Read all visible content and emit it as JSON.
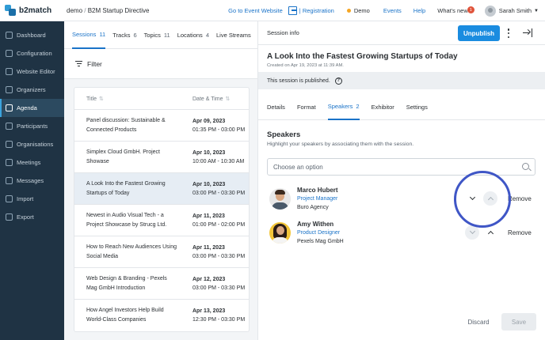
{
  "brand": {
    "name": "b2match"
  },
  "breadcrumb": {
    "org": "demo",
    "event": "B2M Startup Directive"
  },
  "topnav": {
    "go_to_event": "Go to Event Website",
    "registration": "Registration",
    "demo": "Demo",
    "events": "Events",
    "help": "Help",
    "whats_new": "What's new",
    "whats_new_count": "1",
    "user": "Sarah Smith"
  },
  "sidebar": {
    "items": [
      {
        "label": "Dashboard",
        "icon": "dashboard-icon"
      },
      {
        "label": "Configuration",
        "icon": "configuration-icon"
      },
      {
        "label": "Website Editor",
        "icon": "website-editor-icon"
      },
      {
        "label": "Organizers",
        "icon": "organizers-icon"
      },
      {
        "label": "Agenda",
        "icon": "agenda-icon",
        "active": true
      },
      {
        "label": "Participants",
        "icon": "participants-icon"
      },
      {
        "label": "Organisations",
        "icon": "organisations-icon"
      },
      {
        "label": "Meetings",
        "icon": "meetings-icon"
      },
      {
        "label": "Messages",
        "icon": "messages-icon"
      },
      {
        "label": "Import",
        "icon": "import-icon"
      },
      {
        "label": "Export",
        "icon": "export-icon"
      }
    ]
  },
  "agenda_tabs": [
    {
      "label": "Sessions",
      "count": "11",
      "active": true
    },
    {
      "label": "Tracks",
      "count": "6"
    },
    {
      "label": "Topics",
      "count": "11"
    },
    {
      "label": "Locations",
      "count": "4"
    },
    {
      "label": "Live Streams",
      "count": ""
    }
  ],
  "filter": {
    "label": "Filter"
  },
  "sessions_table": {
    "columns": [
      "Title",
      "Date & Time"
    ],
    "rows": [
      {
        "title": "Panel discussion: Sustainable & Connected Products",
        "date": "Apr 09, 2023",
        "time": "01:35 PM - 03:00 PM"
      },
      {
        "title": "Simplex Cloud GmbH. Project Showase",
        "date": "Apr 10, 2023",
        "time": "10:00 AM - 10:30 AM"
      },
      {
        "title": "A Look Into the Fastest Growing Startups of Today",
        "date": "Apr 10, 2023",
        "time": "03:00 PM - 03:30 PM",
        "selected": true
      },
      {
        "title": "Newest in Audio Visual Tech - a Project Showcase by Strucg Ltd.",
        "date": "Apr 11, 2023",
        "time": "01:00 PM - 02:00 PM"
      },
      {
        "title": "How to Reach New Audiences Using Social Media",
        "date": "Apr 11, 2023",
        "time": "03:00 PM - 03:30 PM"
      },
      {
        "title": "Web Design & Branding - Pexels Mag GmbH Introduction",
        "date": "Apr 12, 2023",
        "time": "03:00 PM - 03:30 PM"
      },
      {
        "title": "How Angel Investors Help Build World-Class Companies",
        "date": "Apr 13, 2023",
        "time": "12:30 PM - 03:30 PM"
      }
    ]
  },
  "session_info": {
    "header": "Session info",
    "unpublish": "Unpublish",
    "title": "A Look Into the Fastest Growing Startups of Today",
    "created": "Created on Apr 19, 2023 at 11:39 AM.",
    "published_notice": "This session is published.",
    "tabs": [
      {
        "label": "Details"
      },
      {
        "label": "Format"
      },
      {
        "label": "Speakers",
        "count": "2",
        "active": true
      },
      {
        "label": "Exhibitor"
      },
      {
        "label": "Settings"
      }
    ],
    "speakers_heading": "Speakers",
    "speakers_help": "Highlight your speakers by associating them with the session.",
    "search_placeholder": "Choose an option",
    "speakers": [
      {
        "name": "Marco Hubert",
        "role": "Project Manager",
        "company": "Buro Agency"
      },
      {
        "name": "Amy Withen",
        "role": "Product Designer",
        "company": "Pexels Mag GmbH"
      }
    ],
    "remove_label": "Remove",
    "discard": "Discard",
    "save": "Save"
  },
  "colors": {
    "accent": "#1a8ce0",
    "sidebar_bg": "#1f3344",
    "highlight": "#3f56c6"
  }
}
